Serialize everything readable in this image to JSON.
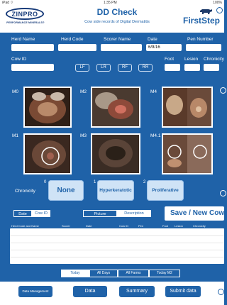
{
  "status": {
    "left": "iPad ⌔",
    "time": "1:35 PM",
    "right": "100%"
  },
  "header": {
    "logo_text": "ZINPRO",
    "logo_sub": "PERFORMANCE MINERALS®",
    "title": "DD Check",
    "subtitle": "Cow side records of Digital Dermatitis",
    "brand": "FirstStep"
  },
  "form": {
    "herd_name_label": "Herd Name",
    "herd_code_label": "Herd Code",
    "scorer_name_label": "Scorer Name",
    "date_label": "Date",
    "date_value": "6/9/16",
    "pen_number_label": "Pen Number",
    "cow_id_label": "Cow ID",
    "foot_label": "Foot",
    "lesion_label": "Lesion",
    "chronicity_label": "Chronicity"
  },
  "toes": [
    "LF",
    "LR",
    "RF",
    "RR"
  ],
  "lesions": [
    "M0",
    "M2",
    "M4",
    "M1",
    "M3",
    "M4.1"
  ],
  "chronicity": {
    "label": "Chronicity",
    "options": [
      {
        "num": "0",
        "label": "None"
      },
      {
        "num": "1",
        "label": "Hyperkeratotic"
      },
      {
        "num": "2",
        "label": "Proliferative"
      }
    ]
  },
  "sort_tabs": [
    "Date",
    "Cow ID"
  ],
  "view_tabs": [
    "Picture",
    "Description"
  ],
  "save_label": "Save / New Cow",
  "table": {
    "columns": [
      "Herd Code and Name",
      "Scorer",
      "Date",
      "Cow ID",
      "Pen",
      "Foot",
      "Lesion",
      "Chronicity"
    ]
  },
  "filters": [
    "Today",
    "All Days",
    "All Farms",
    "Today M2"
  ],
  "nav": [
    "Data Management",
    "Data",
    "Summary",
    "Submit data"
  ],
  "colors": {
    "primary": "#1f62a8",
    "white": "#ffffff"
  }
}
